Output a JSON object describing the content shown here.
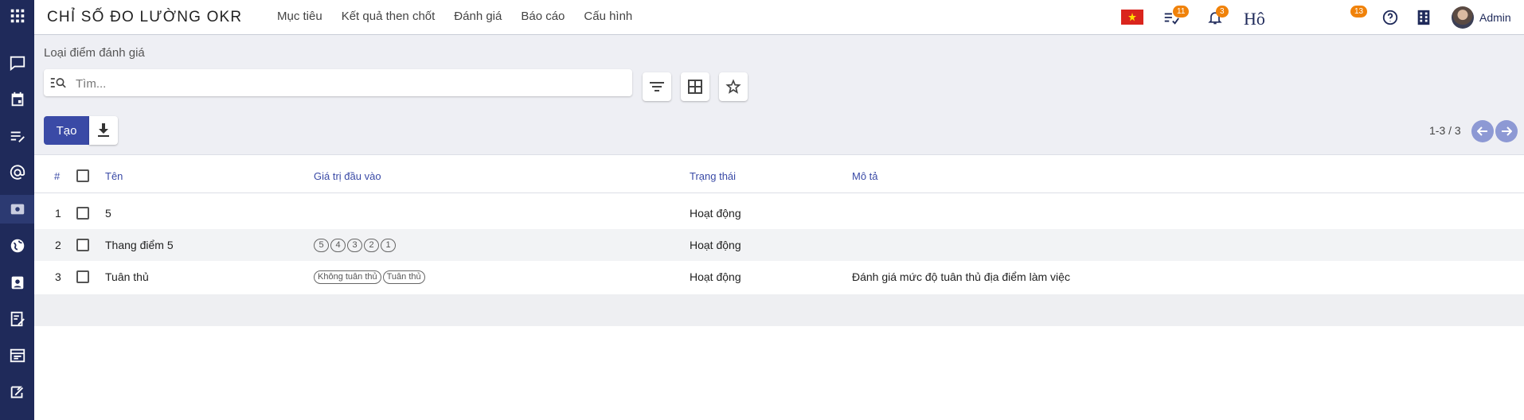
{
  "app": {
    "title": "CHỈ SỐ ĐO LƯỜNG OKR"
  },
  "menu": [
    "Mục tiêu",
    "Kết quả then chốt",
    "Đánh giá",
    "Báo cáo",
    "Cấu hình"
  ],
  "systray": {
    "activity_count": "11",
    "notification_count": "3",
    "company_logo_text": "Hô",
    "discuss_count": "13",
    "user_name": "Admin"
  },
  "breadcrumb": "Loại điểm đánh giá",
  "search": {
    "placeholder": "Tìm..."
  },
  "actions": {
    "create_label": "Tạo"
  },
  "pager": "1-3 / 3",
  "table": {
    "headers": {
      "index": "#",
      "name": "Tên",
      "input_values": "Giá trị đầu vào",
      "status": "Trạng thái",
      "description": "Mô tả"
    },
    "rows": [
      {
        "index": "1",
        "name": "5",
        "tags": [],
        "status": "Hoạt động",
        "description": ""
      },
      {
        "index": "2",
        "name": "Thang điểm 5",
        "tags": [
          "5",
          "4",
          "3",
          "2",
          "1"
        ],
        "status": "Hoạt động",
        "description": ""
      },
      {
        "index": "3",
        "name": "Tuân thủ",
        "tags": [
          "Không tuân thủ",
          "Tuân thủ"
        ],
        "status": "Hoạt động",
        "description": "Đánh giá mức độ tuân thủ địa điểm làm việc"
      }
    ]
  },
  "colors": {
    "sidebar": "#1f2a5a",
    "primary": "#3a4aa6",
    "badge": "#f0820a",
    "nav": "#8d99d4"
  }
}
